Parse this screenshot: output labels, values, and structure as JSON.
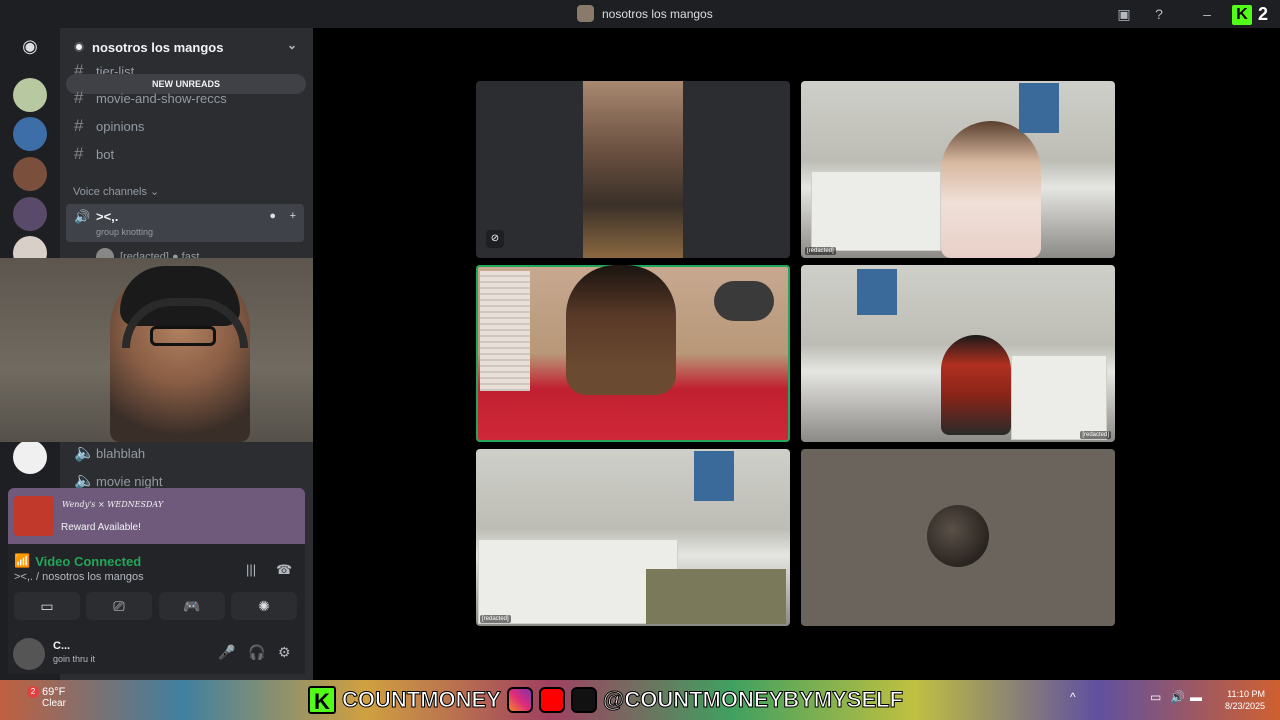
{
  "window": {
    "title": "nosotros los mangos",
    "kick_badge_letter": "K",
    "kick_badge_count": "2"
  },
  "server": {
    "name": "nosotros los mangos",
    "new_unreads": "NEW UNREADS",
    "text_channels": [
      {
        "name": "tier-list"
      },
      {
        "name": "movie-and-show-reccs"
      },
      {
        "name": "opinions"
      },
      {
        "name": "bot"
      }
    ],
    "voice_header": "Voice channels",
    "active_voice": {
      "name": "><,.",
      "subtitle": "group knotting"
    },
    "member_preview": "[redacted] ● fast",
    "other_voice": [
      {
        "name": "blahblah"
      },
      {
        "name": "movie night"
      }
    ]
  },
  "notification": {
    "brand": "Wendy's × WEDNESDAY",
    "text": "Reward Available!"
  },
  "voice_status": {
    "title": "Video Connected",
    "location": "><,. / nosotros los mangos"
  },
  "user": {
    "name": "C...",
    "status": "goin thru it"
  },
  "tiles": {
    "tag_1": "[redacted]",
    "tag_2": "[redacted]",
    "tag_3": "[redacted]"
  },
  "stream_banner": {
    "kick_name": "COUNTMONEY",
    "social_handle": "@COUNTMONEYBYMYSELF"
  },
  "taskbar": {
    "temp": "69°F",
    "condition": "Clear",
    "time": "11:10 PM",
    "date": "8/23/2025",
    "weather_badge": "2"
  },
  "colors": {
    "speaking_border": "#23a55a",
    "kick_green": "#53fc18",
    "notif_bg": "#6f5a7c"
  }
}
